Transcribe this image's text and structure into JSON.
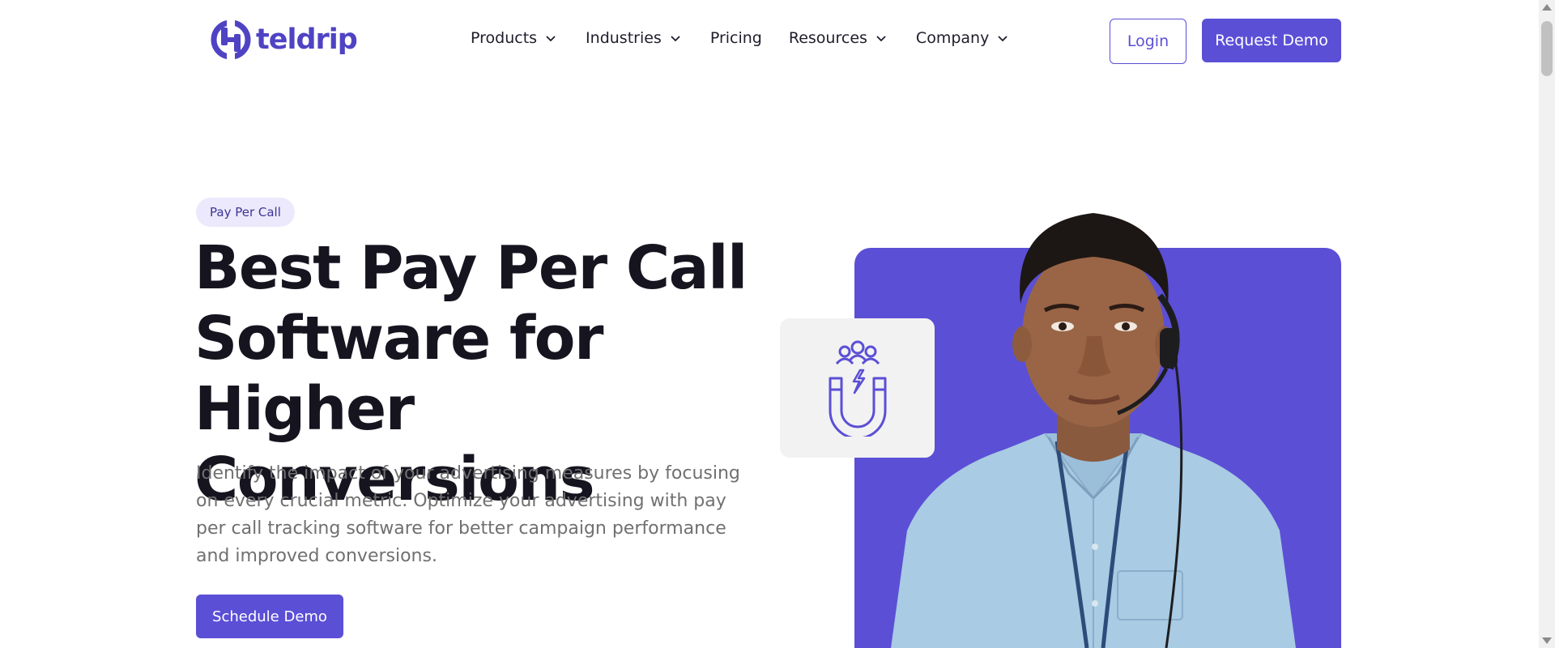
{
  "brand": {
    "name": "teldrip",
    "icon": "teldrip-logo-icon",
    "color": "#4f43c4"
  },
  "nav": {
    "items": [
      {
        "label": "Products",
        "has_dropdown": true
      },
      {
        "label": "Industries",
        "has_dropdown": true
      },
      {
        "label": "Pricing",
        "has_dropdown": false
      },
      {
        "label": "Resources",
        "has_dropdown": true
      },
      {
        "label": "Company",
        "has_dropdown": true
      }
    ],
    "login_label": "Login",
    "request_demo_label": "Request Demo"
  },
  "hero": {
    "badge": "Pay Per Call",
    "title_lines": [
      "Best Pay Per Call",
      "Software for Higher",
      "Conversions"
    ],
    "description": "Identify the impact of your advertising measures by focusing on every crucial metric. Optimize your advertising with pay per call tracking software for better campaign performance and improved conversions.",
    "cta_label": "Schedule Demo",
    "feature_icon": "magnet-people-icon"
  },
  "colors": {
    "accent": "#5b4fd6",
    "badge_bg": "#ebe9fb",
    "icon_card_bg": "#f2f2f2",
    "text_dark": "#15141f",
    "text_muted": "#707070"
  }
}
